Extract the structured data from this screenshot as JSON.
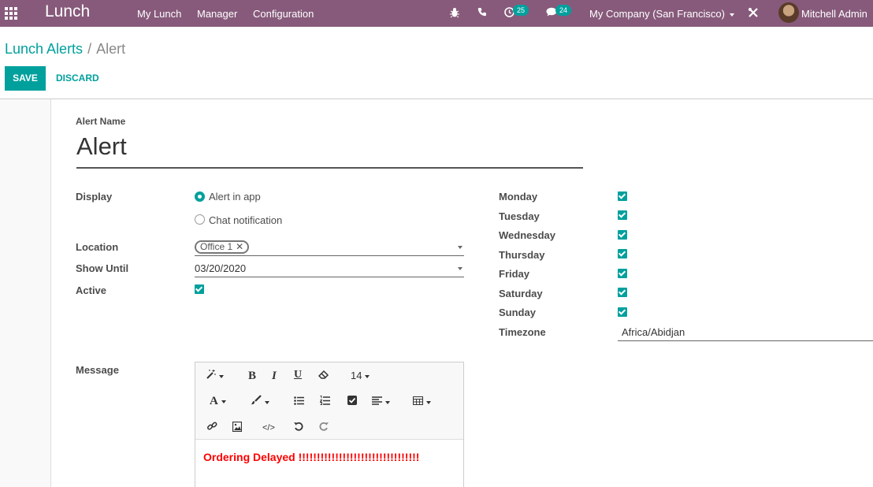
{
  "navbar": {
    "brand": "Lunch",
    "menu": [
      "My Lunch",
      "Manager",
      "Configuration"
    ],
    "activity_count": "25",
    "message_count": "24",
    "company": "My Company (San Francisco)",
    "user": "Mitchell Admin",
    "bg_color": "#875a7b"
  },
  "breadcrumb": {
    "parent": "Lunch Alerts",
    "separator": "/",
    "current": "Alert"
  },
  "buttons": {
    "save": "SAVE",
    "discard": "DISCARD"
  },
  "form": {
    "title_label": "Alert Name",
    "title_value": "Alert",
    "display_label": "Display",
    "display_options": [
      "Alert in app",
      "Chat notification"
    ],
    "display_selected": "Alert in app",
    "location_label": "Location",
    "location_tag": "Office 1",
    "show_until_label": "Show Until",
    "show_until_value": "03/20/2020",
    "active_label": "Active",
    "active": true,
    "days": [
      {
        "label": "Monday",
        "checked": true
      },
      {
        "label": "Tuesday",
        "checked": true
      },
      {
        "label": "Wednesday",
        "checked": true
      },
      {
        "label": "Thursday",
        "checked": true
      },
      {
        "label": "Friday",
        "checked": true
      },
      {
        "label": "Saturday",
        "checked": true
      },
      {
        "label": "Sunday",
        "checked": true
      }
    ],
    "timezone_label": "Timezone",
    "timezone_value": "Africa/Abidjan",
    "message_label": "Message",
    "message_text": "Ordering Delayed !!!!!!!!!!!!!!!!!!!!!!!!!!!!!!!!!",
    "font_size": "14"
  },
  "colors": {
    "accent": "#00a09d",
    "message": "#ff0000"
  }
}
